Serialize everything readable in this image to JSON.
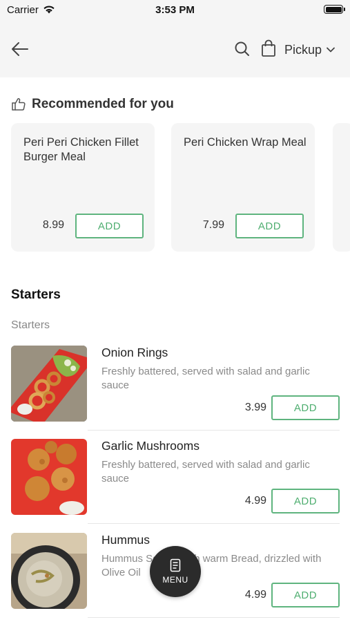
{
  "status_bar": {
    "carrier": "Carrier",
    "time": "3:53 PM"
  },
  "nav": {
    "pickup_label": "Pickup",
    "icons": [
      "back-arrow-icon",
      "search-icon",
      "bag-icon",
      "chevron-down-icon"
    ]
  },
  "recommended": {
    "title": "Recommended for you",
    "icon": "thumbs-up-icon",
    "items": [
      {
        "name": "Peri Peri Chicken Fillet Burger Meal",
        "price": "8.99",
        "add_label": "ADD"
      },
      {
        "name": "Peri Chicken Wrap Meal",
        "price": "7.99",
        "add_label": "ADD"
      }
    ]
  },
  "section": {
    "title": "Starters",
    "subtitle": "Starters",
    "items": [
      {
        "name": "Onion Rings",
        "description": "Freshly battered, served with salad and garlic sauce",
        "price": "3.99",
        "add_label": "ADD"
      },
      {
        "name": "Garlic Mushrooms",
        "description": "Freshly battered, served with salad and garlic sauce",
        "price": "4.99",
        "add_label": "ADD"
      },
      {
        "name": "Hummus",
        "description": "Hummus Served with warm Bread, drizzled with Olive Oil",
        "price": "4.99",
        "add_label": "ADD"
      }
    ]
  },
  "fab": {
    "label": "MENU",
    "icon": "menu-card-icon"
  },
  "colors": {
    "accent": "#4fae70",
    "nav_bg": "#f5f5f5",
    "card_bg": "#f5f5f5",
    "fab_bg": "#2b2b2b"
  }
}
